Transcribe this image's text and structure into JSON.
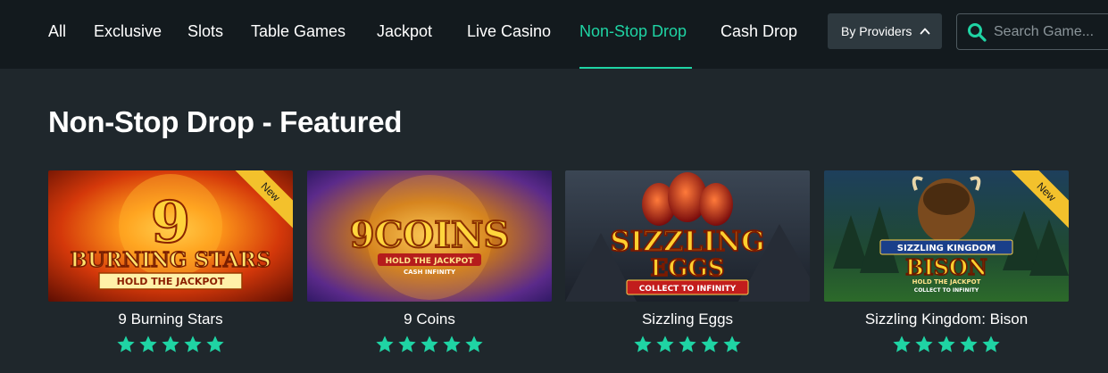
{
  "nav": {
    "items": [
      {
        "label": "All"
      },
      {
        "label": "Exclusive"
      },
      {
        "label": "Slots"
      },
      {
        "label": "Table Games"
      },
      {
        "label": "Jackpot"
      },
      {
        "label": "Live Casino"
      },
      {
        "label": "Non-Stop Drop",
        "active": true
      },
      {
        "label": "Cash Drop"
      }
    ],
    "providers_label": "By Providers",
    "search_placeholder": "Search Game..."
  },
  "section": {
    "title": "Non-Stop Drop - Featured"
  },
  "games": [
    {
      "name": "9 Burning Stars",
      "badge": "New",
      "rating": 5,
      "art": {
        "logo_top": "9",
        "logo_main": "BURNING STARS",
        "logo_sub": "HOLD THE JACKPOT"
      }
    },
    {
      "name": "9 Coins",
      "badge": "",
      "rating": 5,
      "art": {
        "logo_top": "",
        "logo_main": "9COINS",
        "logo_sub": "HOLD THE JACKPOT",
        "logo_sub2": "CASH INFINITY"
      }
    },
    {
      "name": "Sizzling Eggs",
      "badge": "",
      "rating": 5,
      "art": {
        "logo_top": "SIZZLING",
        "logo_main": "EGGS",
        "logo_sub": "COLLECT TO INFINITY"
      }
    },
    {
      "name": "Sizzling Kingdom: Bison",
      "badge": "New",
      "rating": 5,
      "art": {
        "logo_top": "SIZZLING KINGDOM",
        "logo_main": "BISON",
        "logo_sub": "HOLD THE JACKPOT",
        "logo_sub2": "COLLECT TO INFINITY"
      }
    }
  ],
  "colors": {
    "accent": "#1fd4a4",
    "topbar_bg": "#131a1e",
    "page_bg": "#1f272c",
    "badge": "#f3c12c"
  },
  "icons": {
    "search": "search-icon",
    "providers_toggle": "chevron-up-icon",
    "rating": "star-icon"
  }
}
